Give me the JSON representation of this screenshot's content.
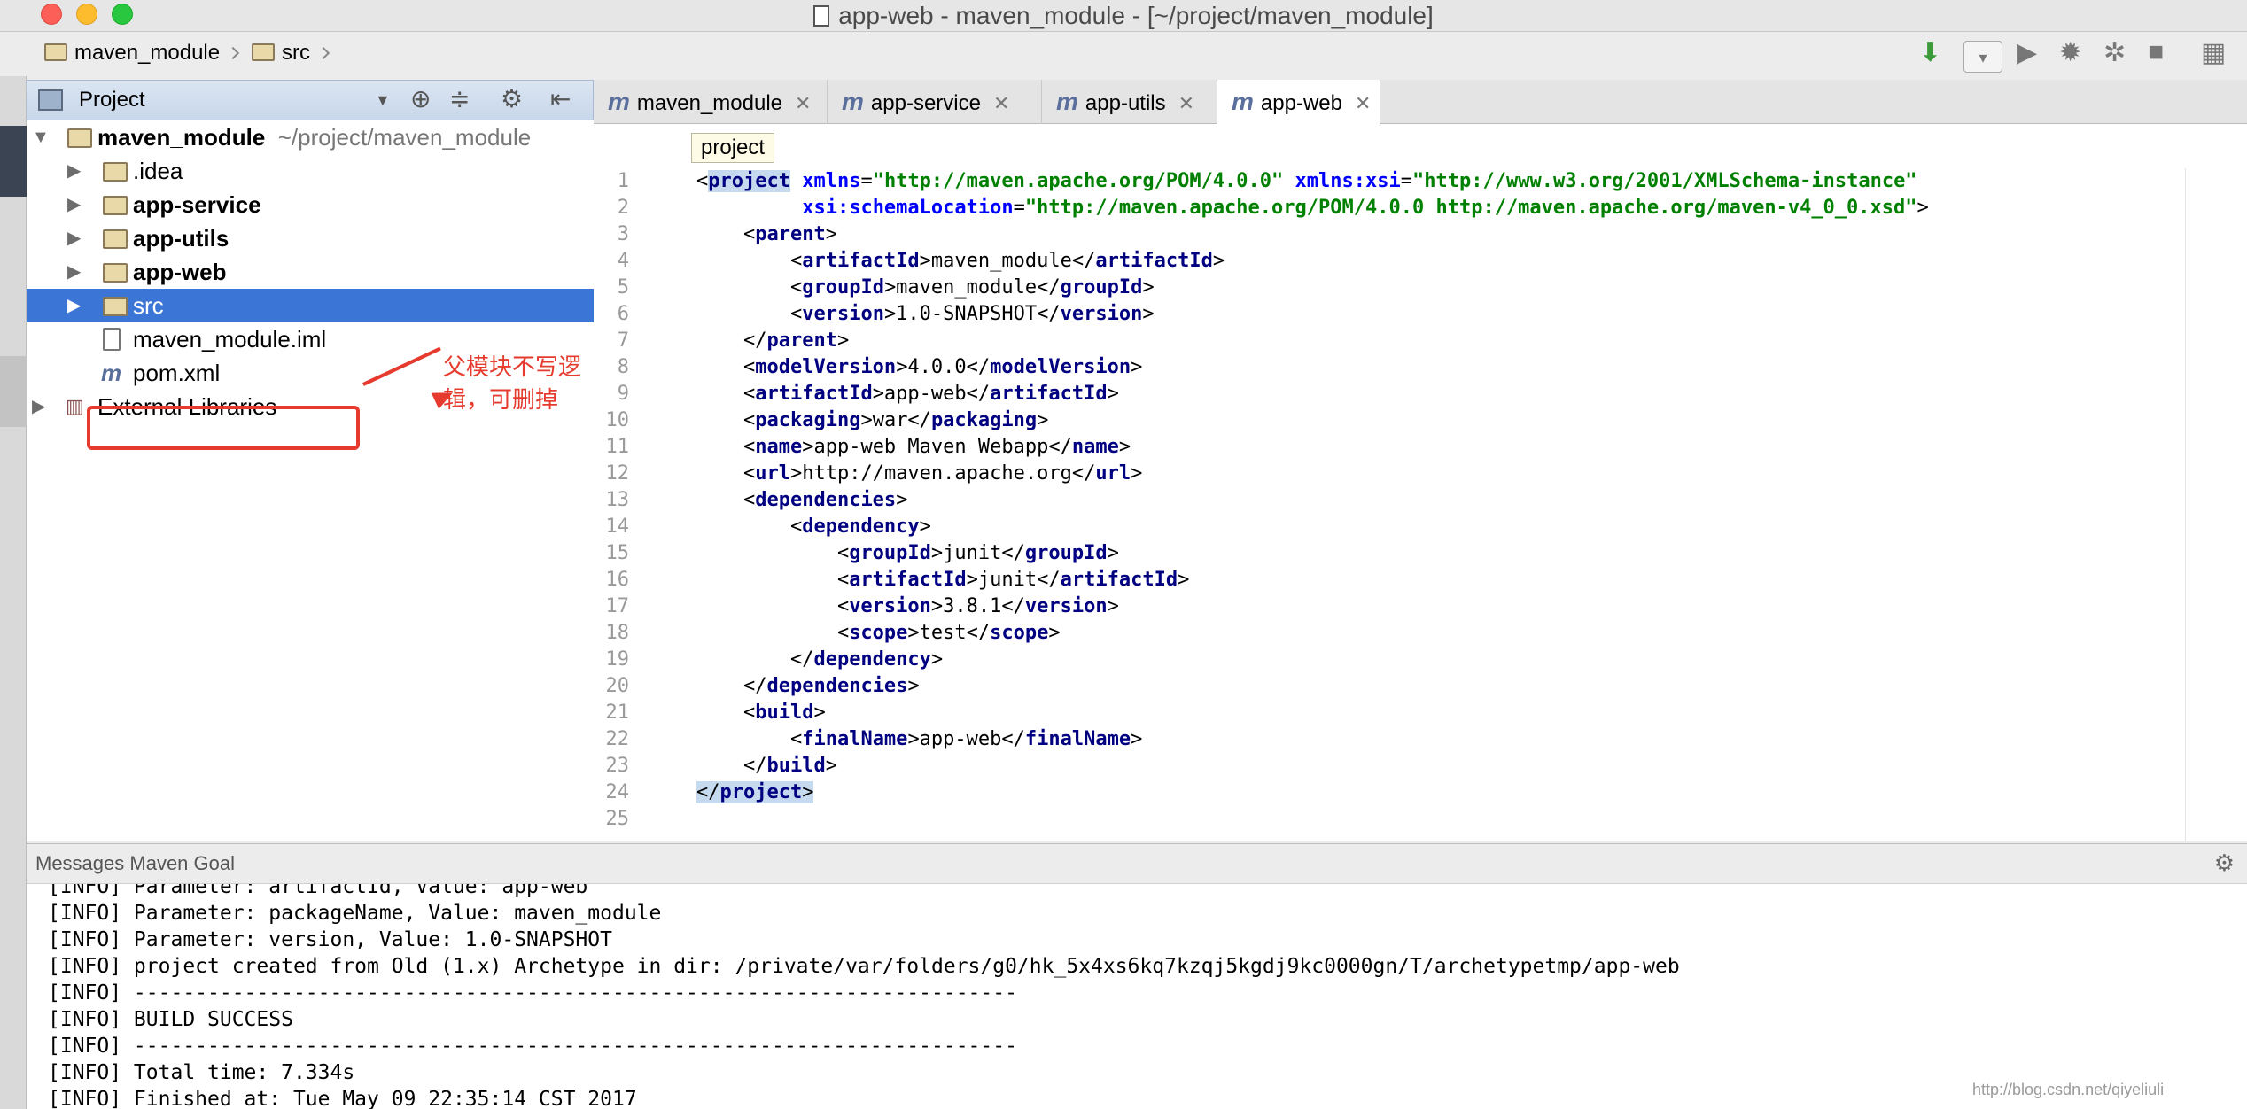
{
  "window": {
    "title": "app-web - maven_module - [~/project/maven_module]"
  },
  "navbar": {
    "crumbs": [
      "maven_module",
      "src"
    ]
  },
  "project_panel": {
    "title": "Project",
    "tree": [
      {
        "label": "maven_module",
        "suffix": "~/project/maven_module",
        "bold": true
      },
      {
        "label": ".idea"
      },
      {
        "label": "app-service",
        "bold": true
      },
      {
        "label": "app-utils",
        "bold": true
      },
      {
        "label": "app-web",
        "bold": true
      },
      {
        "label": "src",
        "selected": true
      },
      {
        "label": "maven_module.iml"
      },
      {
        "label": "pom.xml"
      },
      {
        "label": "External Libraries"
      }
    ]
  },
  "annotation": {
    "text": "父模块不写逻辑，可删掉"
  },
  "editor": {
    "tabs": [
      "maven_module",
      "app-service",
      "app-utils",
      "app-web"
    ],
    "active_tab": "app-web",
    "tooltip": "project",
    "line_numbers": [
      "1",
      "2",
      "3",
      "4",
      "5",
      "6",
      "7",
      "8",
      "9",
      "10",
      "11",
      "12",
      "13",
      "14",
      "15",
      "16",
      "17",
      "18",
      "19",
      "20",
      "21",
      "22",
      "23",
      "24",
      "25"
    ],
    "code": [
      "<project xmlns=\"http://maven.apache.org/POM/4.0.0\" xmlns:xsi=\"http://www.w3.org/2001/XMLSchema-instance\"",
      "         xsi:schemaLocation=\"http://maven.apache.org/POM/4.0.0 http://maven.apache.org/maven-v4_0_0.xsd\">",
      "    <parent>",
      "        <artifactId>maven_module</artifactId>",
      "        <groupId>maven_module</groupId>",
      "        <version>1.0-SNAPSHOT</version>",
      "    </parent>",
      "    <modelVersion>4.0.0</modelVersion>",
      "    <artifactId>app-web</artifactId>",
      "    <packaging>war</packaging>",
      "    <name>app-web Maven Webapp</name>",
      "    <url>http://maven.apache.org</url>",
      "    <dependencies>",
      "        <dependency>",
      "            <groupId>junit</groupId>",
      "            <artifactId>junit</artifactId>",
      "            <version>3.8.1</version>",
      "            <scope>test</scope>",
      "        </dependency>",
      "    </dependencies>",
      "    <build>",
      "        <finalName>app-web</finalName>",
      "    </build>",
      "</project>",
      ""
    ]
  },
  "messages": {
    "title": "Messages Maven Goal",
    "lines": [
      "[INFO] Parameter: artifactId, Value: app-web",
      "[INFO] Parameter: packageName, Value: maven_module",
      "[INFO] Parameter: version, Value: 1.0-SNAPSHOT",
      "[INFO] project created from Old (1.x) Archetype in dir: /private/var/folders/g0/hk_5x4xs6kq7kzqj5kgdj9kc0000gn/T/archetypetmp/app-web",
      "[INFO] ------------------------------------------------------------------------",
      "[INFO] BUILD SUCCESS",
      "[INFO] ------------------------------------------------------------------------",
      "[INFO] Total time: 7.334s",
      "[INFO] Finished at: Tue May 09 22:35:14 CST 2017"
    ]
  },
  "watermark": "http://blog.csdn.net/qiyeliuli"
}
